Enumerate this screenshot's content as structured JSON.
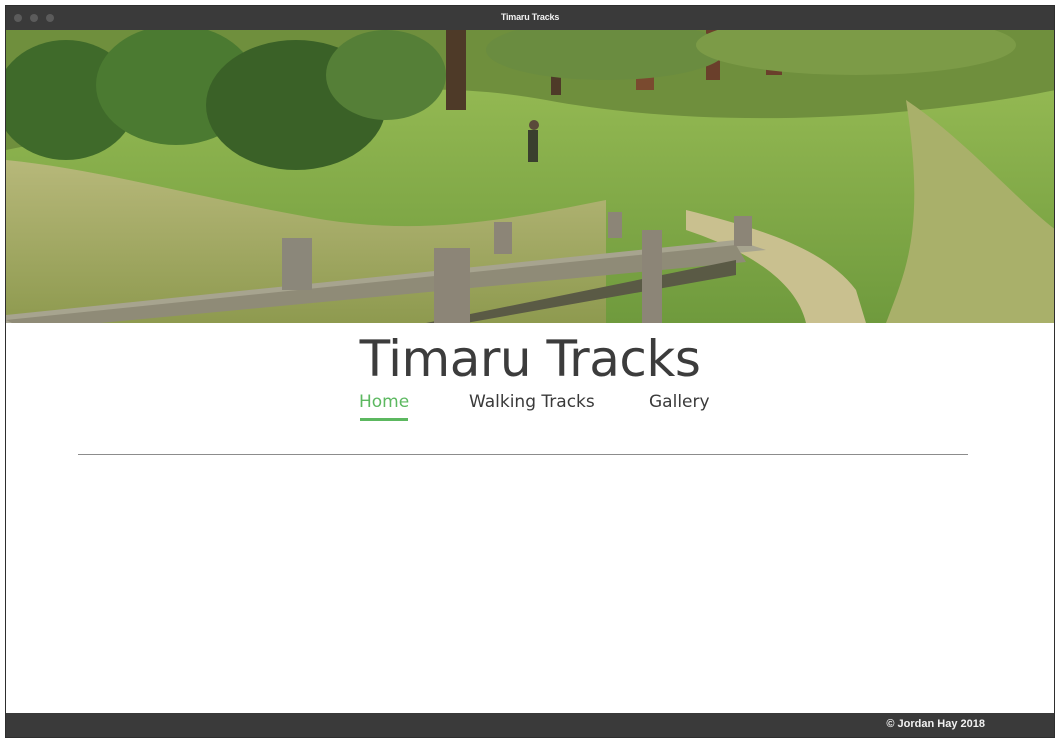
{
  "window": {
    "title": "Timaru Tracks"
  },
  "hero": {
    "image_icon": "landscape-photo-icon"
  },
  "site": {
    "title": "Timaru Tracks"
  },
  "nav": {
    "items": [
      {
        "label": "Home",
        "active": true
      },
      {
        "label": "Walking Tracks",
        "active": false
      },
      {
        "label": "Gallery",
        "active": false
      }
    ]
  },
  "footer": {
    "copyright": "© Jordan Hay 2018"
  },
  "colors": {
    "accent": "#5cb860",
    "titlebar": "#3a3a3a",
    "text": "#3c3c3c"
  }
}
